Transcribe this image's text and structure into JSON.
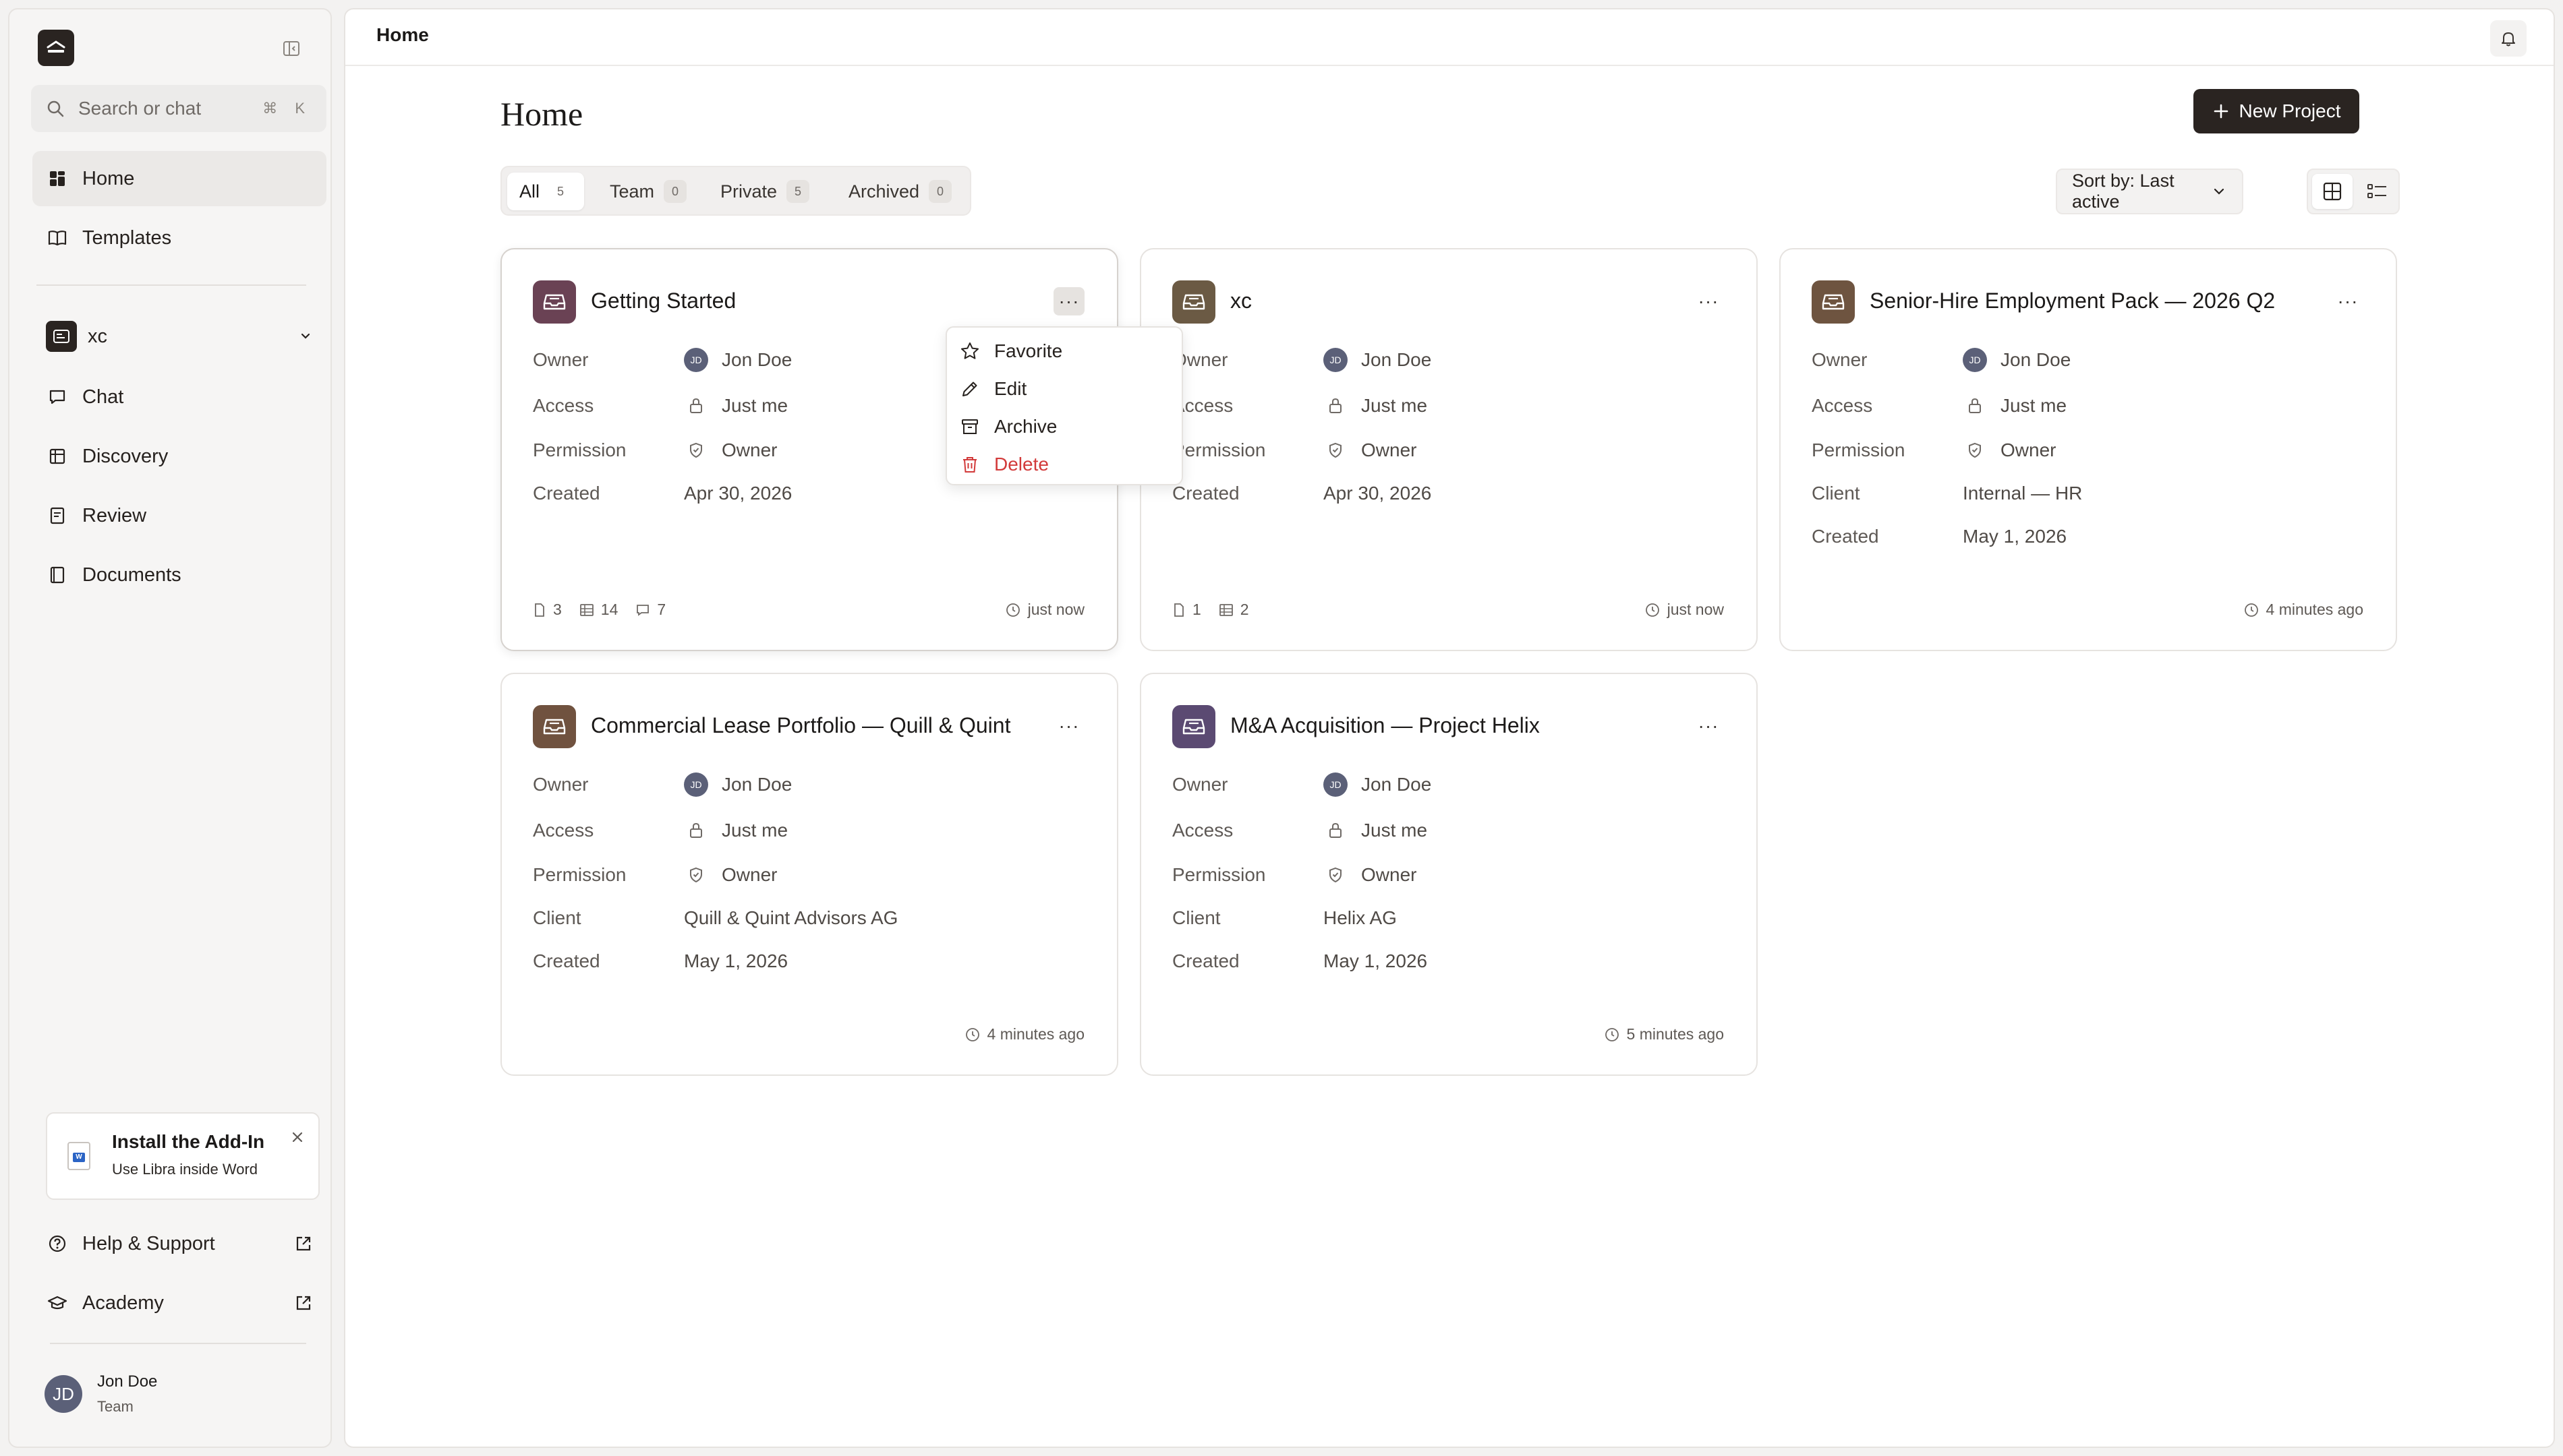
{
  "sidebar": {
    "search_placeholder": "Search or chat",
    "search_shortcut": "⌘ K",
    "nav": [
      {
        "label": "Home",
        "icon": "grid-icon"
      },
      {
        "label": "Templates",
        "icon": "book-icon"
      }
    ],
    "workspace": {
      "name": "xc"
    },
    "workspace_nav": [
      {
        "label": "Chat",
        "icon": "chat-icon"
      },
      {
        "label": "Discovery",
        "icon": "table-icon"
      },
      {
        "label": "Review",
        "icon": "review-icon"
      },
      {
        "label": "Documents",
        "icon": "notebook-icon"
      }
    ],
    "addin": {
      "title": "Install the Add-In",
      "subtitle": "Use Libra inside Word",
      "doc_letter": "W"
    },
    "footer": [
      {
        "label": "Help & Support",
        "icon": "help-icon"
      },
      {
        "label": "Academy",
        "icon": "academy-icon"
      }
    ],
    "user": {
      "name": "Jon Doe",
      "role": "Team",
      "initials": "JD"
    }
  },
  "topbar": {
    "breadcrumb": "Home"
  },
  "main": {
    "title": "Home",
    "new_project_label": "New Project",
    "tabs": [
      {
        "label": "All",
        "count": "5"
      },
      {
        "label": "Team",
        "count": "0"
      },
      {
        "label": "Private",
        "count": "5"
      },
      {
        "label": "Archived",
        "count": "0"
      }
    ],
    "sort_label": "Sort by: Last active"
  },
  "field_labels": {
    "owner": "Owner",
    "access": "Access",
    "permission": "Permission",
    "client": "Client",
    "created": "Created"
  },
  "projects": [
    {
      "title": "Getting Started",
      "icon_color": "#6a4254",
      "owner": "Jon Doe",
      "owner_initials": "JD",
      "access": "Just me",
      "permission": "Owner",
      "created": "Apr 30, 2026",
      "docs": "3",
      "tables": "14",
      "chats": "7",
      "last_active": "just now"
    },
    {
      "title": "xc",
      "icon_color": "#6b5a44",
      "owner": "Jon Doe",
      "owner_initials": "JD",
      "access": "Just me",
      "permission": "Owner",
      "created": "Apr 30, 2026",
      "docs": "1",
      "tables": "2",
      "last_active": "just now"
    },
    {
      "title": "Senior-Hire Employment Pack — 2026 Q2",
      "icon_color": "#6e5440",
      "owner": "Jon Doe",
      "owner_initials": "JD",
      "access": "Just me",
      "permission": "Owner",
      "client": "Internal — HR",
      "created": "May 1, 2026",
      "last_active": "4 minutes ago"
    },
    {
      "title": "Commercial Lease Portfolio — Quill & Quint",
      "icon_color": "#70523f",
      "owner": "Jon Doe",
      "owner_initials": "JD",
      "access": "Just me",
      "permission": "Owner",
      "client": "Quill & Quint Advisors AG",
      "created": "May 1, 2026",
      "last_active": "4 minutes ago"
    },
    {
      "title": "M&A Acquisition — Project Helix",
      "icon_color": "#5b4a72",
      "owner": "Jon Doe",
      "owner_initials": "JD",
      "access": "Just me",
      "permission": "Owner",
      "client": "Helix AG",
      "created": "May 1, 2026",
      "last_active": "5 minutes ago"
    }
  ],
  "context_menu": {
    "favorite": "Favorite",
    "edit": "Edit",
    "archive": "Archive",
    "delete": "Delete"
  },
  "colors": {
    "accent_dark": "#2a2421",
    "danger": "#d23a3a"
  }
}
